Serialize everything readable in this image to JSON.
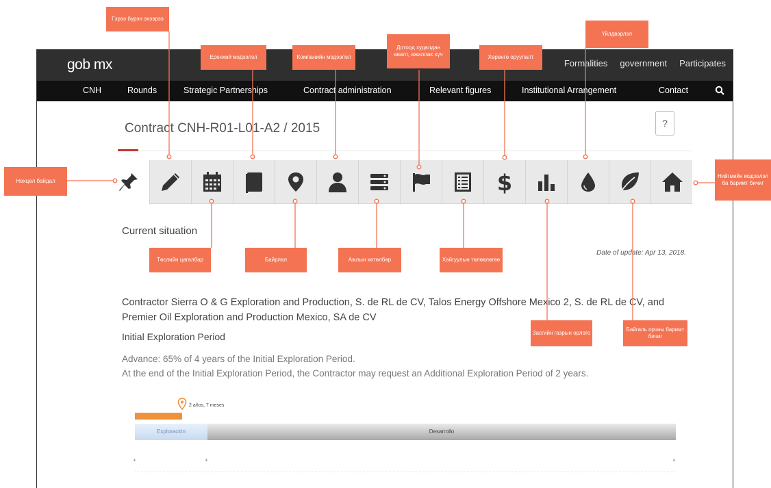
{
  "header": {
    "logo": "gob mx",
    "links": [
      "Formalities",
      "government",
      "Participates"
    ]
  },
  "nav": {
    "items": [
      "CNH",
      "Rounds",
      "Strategic Partnerships",
      "Contract administration",
      "Relevant figures",
      "Institutional Arrangement",
      "Contact"
    ]
  },
  "page": {
    "title": "Contract CNH-R01-L01-A2 / 2015",
    "help": "?",
    "section_title": "Current situation",
    "date_of_update": "Date of update: Apr 13, 2018.",
    "contractor": "Contractor Sierra O & G Exploration and Production, S. de RL de CV, Talos Energy Offshore Mexico 2, S. de RL de CV, and Premier Oil Exploration and Production Mexico, SA de CV",
    "period": "Initial Exploration Period",
    "advance_line1": "Advance: 65% of 4 years of the Initial Exploration Period.",
    "advance_line2": "At the end of the Initial Exploration Period, the Contractor may request an Additional Exploration Period of 2 years."
  },
  "timeline": {
    "marker_label": "2 años, 7 meses",
    "exploration": "Exploración",
    "development": "Desarrollo",
    "progress": 0.65,
    "tick_start": "4",
    "tick_mid": "4",
    "tick_end": "4"
  },
  "icons": [
    "pin-icon",
    "pencil-icon",
    "calendar-icon",
    "document-icon",
    "location-icon",
    "person-icon",
    "list-icon",
    "flag-icon",
    "checklist-icon",
    "dollar-icon",
    "bar-chart-icon",
    "drop-icon",
    "leaf-icon",
    "home-icon"
  ],
  "annotations": {
    "a1": "Гэрээ бүрэн эхээрээ",
    "a2": "Еренхий мэдээлэл",
    "a3": "Компанийн мэдээлэл",
    "a4": "Дотоод худалдан авалт, ажиллах хүч",
    "a5": "Хөрөнгө оруулалт",
    "a6": "Үйлдвэрлэл",
    "a7": "Нөхцөл байдал",
    "a8": "Нийгмийн мэдээлэл ба баримт бичиг",
    "a9": "Төслийн цагалбар",
    "a10": "Байрлал",
    "a11": "Ажлын хөтөлбөр",
    "a12": "Хайгуулын төлөвлөгөө",
    "a13": "Засгийн газрын орлого",
    "a14": "Байгаль орчны баримт бичиг"
  },
  "colors": {
    "annotation": "#f47353",
    "title_underline": "#c0392b",
    "progress_bar": "#f0923a"
  }
}
